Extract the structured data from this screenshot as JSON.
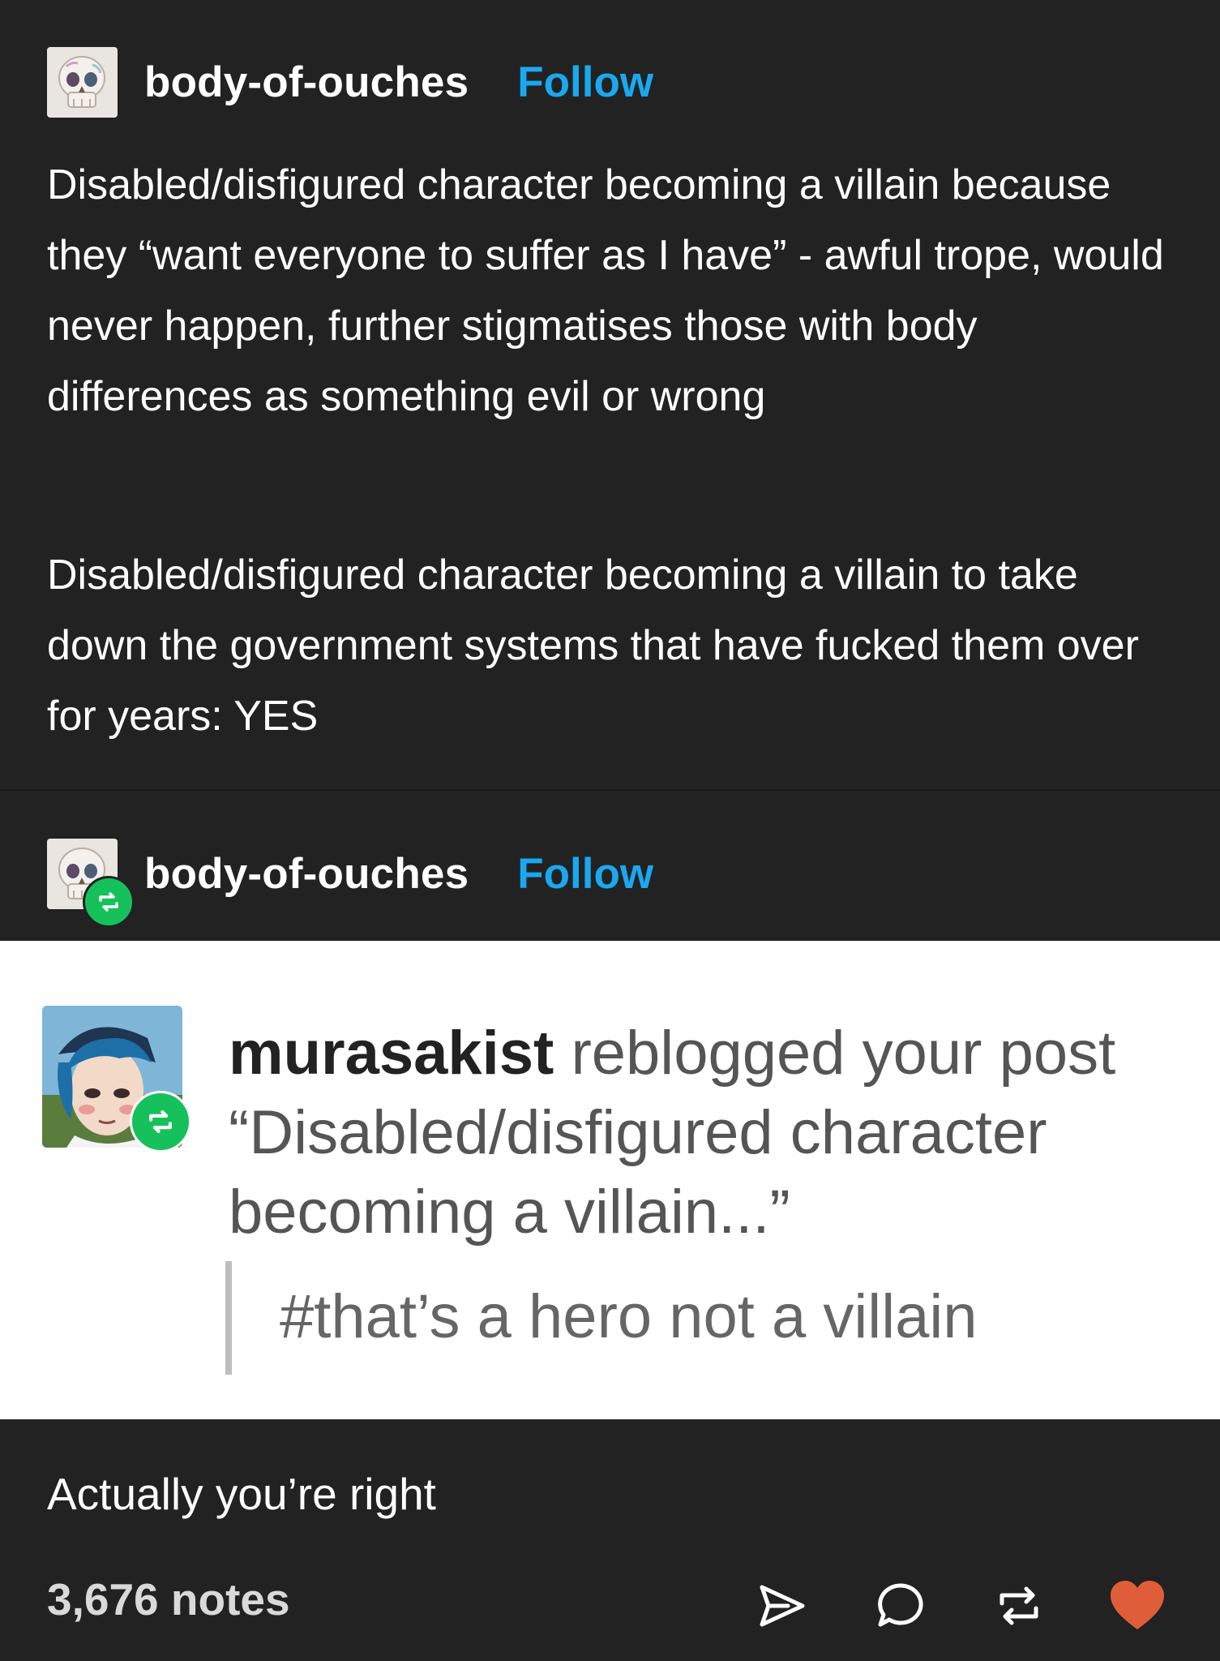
{
  "colors": {
    "background": "#222222",
    "follow_link": "#1aa8f0",
    "reblog_green": "#16c15c",
    "heart": "#e05d3a",
    "screenshot_bg": "#ffffff"
  },
  "post": {
    "username": "body-of-ouches",
    "follow_label": "Follow",
    "paragraph_1": "Disabled/disfigured character becoming a villain because they “want everyone to suffer as I have” - awful trope, would never happen, further stigmatises those with body differences as something evil or wrong",
    "paragraph_2": "Disabled/disfigured character becoming a villain to take down the government systems that have fucked them over for years: YES"
  },
  "reblog": {
    "username": "body-of-ouches",
    "follow_label": "Follow",
    "notification": {
      "reblogger": "murasakist",
      "action_text": " reblogged your post",
      "post_quote": "“Disabled/disfigured character becoming a villain...”",
      "tag": "#that’s a hero not a villain"
    },
    "reply": "Actually you’re right"
  },
  "footer": {
    "notes": "3,676 notes",
    "icons": [
      "send-icon",
      "comment-icon",
      "reblog-icon",
      "heart-icon"
    ]
  }
}
